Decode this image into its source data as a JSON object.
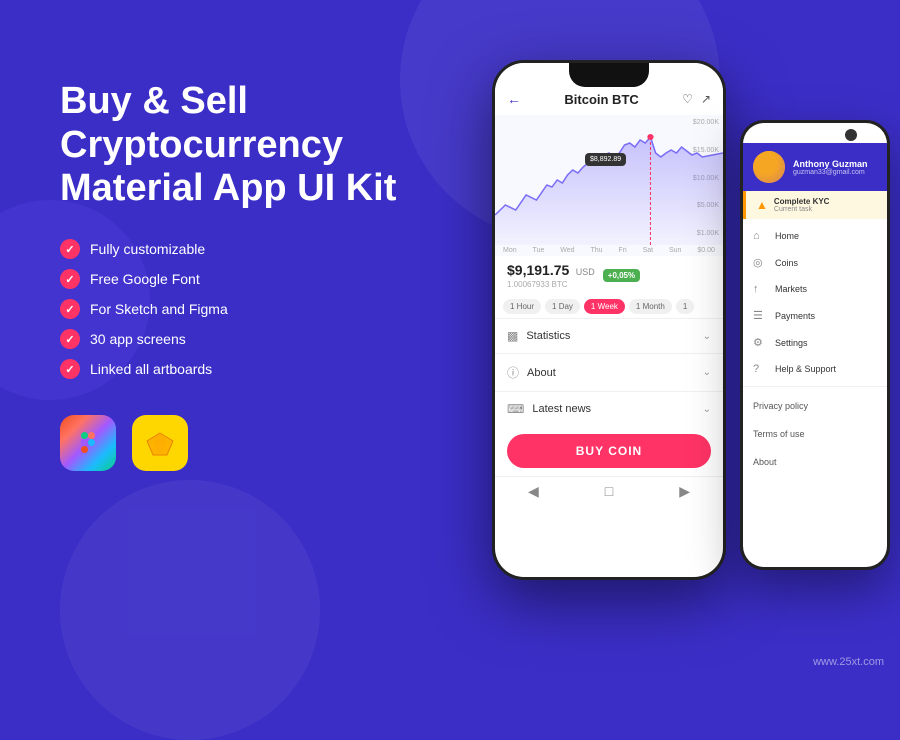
{
  "background": "#3b2ec7",
  "title": {
    "line1": "Buy & Sell",
    "line2": "Cryptocurrency",
    "line3": "Material App UI Kit"
  },
  "features": [
    "Fully customizable",
    "Free Google Font",
    "For Sketch and Figma",
    "30 app screens",
    "Linked all artboards"
  ],
  "tools": [
    {
      "name": "Figma",
      "icon": "figma-icon"
    },
    {
      "name": "Sketch",
      "icon": "sketch-icon"
    }
  ],
  "mainPhone": {
    "coin": "Bitcoin BTC",
    "chartLabels": {
      "y": [
        "$20.00K",
        "$15.00K",
        "$10.00K",
        "$5.00K",
        "$1.00K"
      ],
      "x": [
        "Mon",
        "Tue",
        "Wed",
        "Thu",
        "Fri",
        "Sat",
        "Sun",
        "$0.00"
      ]
    },
    "tooltip": "$8,892.89",
    "price": "$9,191.75",
    "currency": "USD",
    "change": "+0,05%",
    "btc": "1.00067933 BTC",
    "timeFilters": [
      "1 Hour",
      "1 Day",
      "1 Week",
      "1 Month",
      "1"
    ],
    "activeFilter": "1 Week",
    "sections": [
      {
        "label": "Statistics",
        "icon": "bar-chart-icon"
      },
      {
        "label": "About",
        "icon": "info-icon"
      },
      {
        "label": "Latest news",
        "icon": "newspaper-icon"
      }
    ],
    "buyButton": "BUY COIN"
  },
  "secondPhone": {
    "user": {
      "name": "Anthony Guzman",
      "email": "guzman33@gmail.com"
    },
    "kyc": {
      "title": "Complete KYC",
      "subtitle": "Current task"
    },
    "menuItems": [
      {
        "icon": "home-icon",
        "label": "Home"
      },
      {
        "icon": "coins-icon",
        "label": "Coins"
      },
      {
        "icon": "markets-icon",
        "label": "Markets"
      },
      {
        "icon": "payments-icon",
        "label": "Payments"
      },
      {
        "icon": "settings-icon",
        "label": "Settings"
      },
      {
        "icon": "help-icon",
        "label": "Help & Support"
      }
    ],
    "plainLinks": [
      "Privacy policy",
      "Terms of use",
      "About"
    ]
  },
  "watermark": "www.25xt.com"
}
